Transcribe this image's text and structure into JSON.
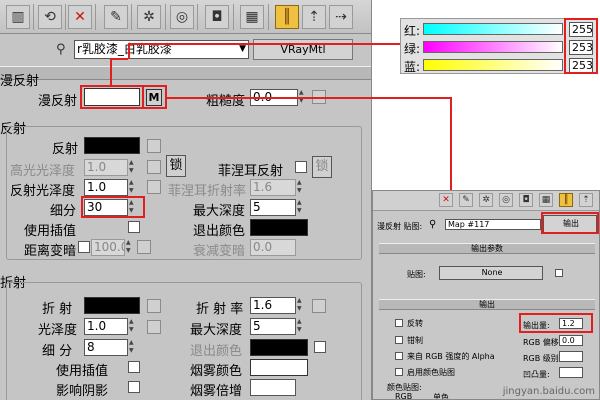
{
  "toolbar_icons": [
    "material-slot-icon",
    "put-to-scene-icon",
    "delete-icon",
    "copy-icon",
    "unique-icon",
    "put-library-icon",
    "material-id-icon",
    "show-in-viewport-icon",
    "show-end-result-icon",
    "go-parent-icon",
    "go-sibling-icon"
  ],
  "material": {
    "name": "r乳胶漆_白乳胶漆",
    "type": "VRayMtl",
    "dropdown_glyph": "▼"
  },
  "diffuse": {
    "section": "漫反射",
    "label": "漫反射",
    "map_button": "M",
    "roughness_label": "粗糙度",
    "roughness_value": "0.0",
    "swatch_color": "#ffffff"
  },
  "reflection": {
    "section": "反射",
    "reflect_label": "反射",
    "reflect_color": "#000000",
    "hilight_gloss_label": "高光光泽度",
    "hilight_gloss_value": "1.0",
    "lock_label": "锁",
    "fresnel_label": "菲涅耳反射",
    "fresnel_lock": "锁",
    "refl_gloss_label": "反射光泽度",
    "refl_gloss_value": "1.0",
    "fresnel_ior_label": "菲涅耳折射率",
    "fresnel_ior_value": "1.6",
    "subdivs_label": "细分",
    "subdivs_value": "30",
    "max_depth_label": "最大深度",
    "max_depth_value": "5",
    "use_interp_label": "使用插值",
    "exit_color_label": "退出颜色",
    "exit_color": "#000000",
    "dim_distance_label": "距离变暗",
    "dim_distance_value": "100.0m",
    "dim_falloff_label": "衰减变暗",
    "dim_falloff_value": "0.0"
  },
  "refraction": {
    "section": "折射",
    "refract_label": "折 射",
    "refract_color": "#000000",
    "ior_label": "折 射 率",
    "ior_value": "1.6",
    "gloss_label": "光泽度",
    "gloss_value": "1.0",
    "max_depth_label": "最大深度",
    "max_depth_value": "5",
    "subdivs_label": "细 分",
    "subdivs_value": "8",
    "exit_color_label": "退出颜色",
    "exit_color": "#000000",
    "use_interp_label": "使用插值",
    "fog_color_label": "烟雾颜色",
    "fog_color": "#ffffff",
    "affect_shadows_label": "影响阴影",
    "fog_mult_label": "烟雾倍增"
  },
  "color_dialog": {
    "rows": [
      {
        "label": "红:",
        "value": "255",
        "gradient": "linear-gradient(to right, #00ffff, #ffffff)"
      },
      {
        "label": "绿:",
        "value": "253",
        "gradient": "linear-gradient(to right, #ff00ff, #ffffff)"
      },
      {
        "label": "蓝:",
        "value": "253",
        "gradient": "linear-gradient(to right, #ffff00, #ffffff)"
      }
    ]
  },
  "output_dialog": {
    "slot_label": "漫反射 贴图:",
    "map_name": "Map #117",
    "type_button": "输出",
    "output_params_rollout": "输出参数",
    "map_label": "贴图:",
    "map_value": "None",
    "output_rollout": "输出",
    "invert_label": "反转",
    "clamp_label": "钳制",
    "alpha_from_rgb_label": "来自 RGB 强度的 Alpha",
    "enable_color_map_label": "启用颜色贴图",
    "output_amount_label": "输出量:",
    "output_amount_value": "1.2",
    "rgb_offset_label": "RGB 偏移:",
    "rgb_offset_value": "0.0",
    "rgb_level_label": "RGB 级别:",
    "bump_amount_label": "凹凸量:",
    "color_map_label": "颜色贴图:",
    "rgb_option": "RGB",
    "mono_option": "单色",
    "watermark": "jingyan.baidu.com"
  }
}
